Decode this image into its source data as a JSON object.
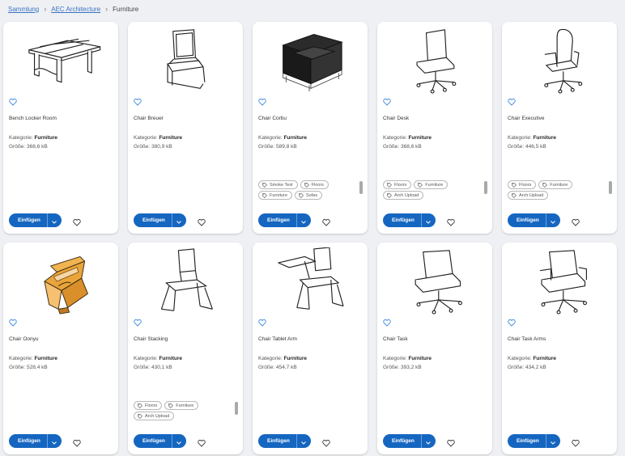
{
  "breadcrumb": {
    "items": [
      {
        "label": "Sammlung"
      },
      {
        "label": "AEC Architecture"
      }
    ],
    "current": "Furniture"
  },
  "labels": {
    "category": "Kategorie:",
    "size": "Größe:",
    "insert": "Einfügen"
  },
  "colors": {
    "accent": "#1566c0",
    "favorite": "#4a90e2",
    "link": "#3a73c4"
  },
  "cards": [
    {
      "name": "Bench Locker Room",
      "category": "Furniture",
      "size": "368,6 kB",
      "icon": "bench-image",
      "tags": []
    },
    {
      "name": "Chair Breuer",
      "category": "Furniture",
      "size": "380,9 kB",
      "icon": "cantilever-chair-image",
      "tags": []
    },
    {
      "name": "Chair Corbu",
      "category": "Furniture",
      "size": "589,8 kB",
      "icon": "armchair-image",
      "tags": [
        "Smoke Test",
        "Floors",
        "Furniture",
        "Sofas"
      ]
    },
    {
      "name": "Chair Desk",
      "category": "Furniture",
      "size": "368,6 kB",
      "icon": "desk-chair-image",
      "tags": [
        "Floors",
        "Furniture",
        "Arch Upload"
      ]
    },
    {
      "name": "Chair Executive",
      "category": "Furniture",
      "size": "446,5 kB",
      "icon": "executive-chair-image",
      "tags": [
        "Floors",
        "Furniture",
        "Arch Upload"
      ]
    },
    {
      "name": "Chair Oonyu",
      "category": "Furniture",
      "size": "528,4 kB",
      "icon": "oonyu-chair-image",
      "tags": []
    },
    {
      "name": "Chair Stacking",
      "category": "Furniture",
      "size": "430,1 kB",
      "icon": "stacking-chair-image",
      "tags": [
        "Floors",
        "Furniture",
        "Arch Upload"
      ]
    },
    {
      "name": "Chair Tablet Arm",
      "category": "Furniture",
      "size": "454,7 kB",
      "icon": "tablet-arm-chair-image",
      "tags": []
    },
    {
      "name": "Chair Task",
      "category": "Furniture",
      "size": "393,2 kB",
      "icon": "task-chair-image",
      "tags": []
    },
    {
      "name": "Chair Task Arms",
      "category": "Furniture",
      "size": "434,2 kB",
      "icon": "task-chair-arms-image",
      "tags": []
    }
  ]
}
